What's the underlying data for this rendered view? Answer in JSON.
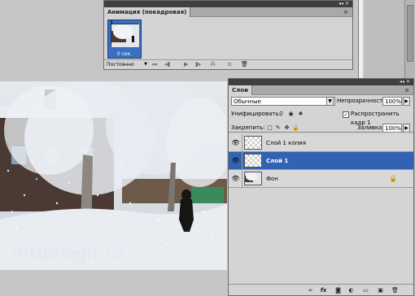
{
  "animation_panel": {
    "title": "Анимация (покадровая)",
    "frame_number": "1",
    "frame_delay": "0 сек.",
    "loop_option": "Постоянно",
    "controls": [
      "first-frame-icon",
      "prev-frame-icon",
      "play-icon",
      "next-frame-icon",
      "tween-icon",
      "duplicate-frame-icon",
      "delete-frame-icon"
    ]
  },
  "layers_panel": {
    "title": "Слои",
    "blend_mode": "Обычные",
    "opacity_label": "Непрозрачность:",
    "opacity_value": "100%",
    "unify_label": "Унифицировать:",
    "propagate_label": "Распространить кадр 1",
    "propagate_checked": true,
    "lock_label": "Закрепить:",
    "fill_label": "Заливка:",
    "fill_value": "100%",
    "layers": [
      {
        "name": "Слой 1 копия",
        "visible": true,
        "selected": false
      },
      {
        "name": "Слой 1",
        "visible": true,
        "selected": true
      },
      {
        "name": "Фон",
        "visible": true,
        "selected": false,
        "locked": true
      }
    ],
    "footer_icons": [
      "link-icon",
      "fx-icon",
      "mask-icon",
      "adjustment-icon",
      "group-icon",
      "new-layer-icon",
      "trash-icon"
    ]
  },
  "canvas": {
    "watermark": "mtdesign.ru"
  },
  "colors": {
    "selection_blue": "#3162b4",
    "panel_grey": "#d4d4d4",
    "panel_bar": "#3f3f3f"
  }
}
